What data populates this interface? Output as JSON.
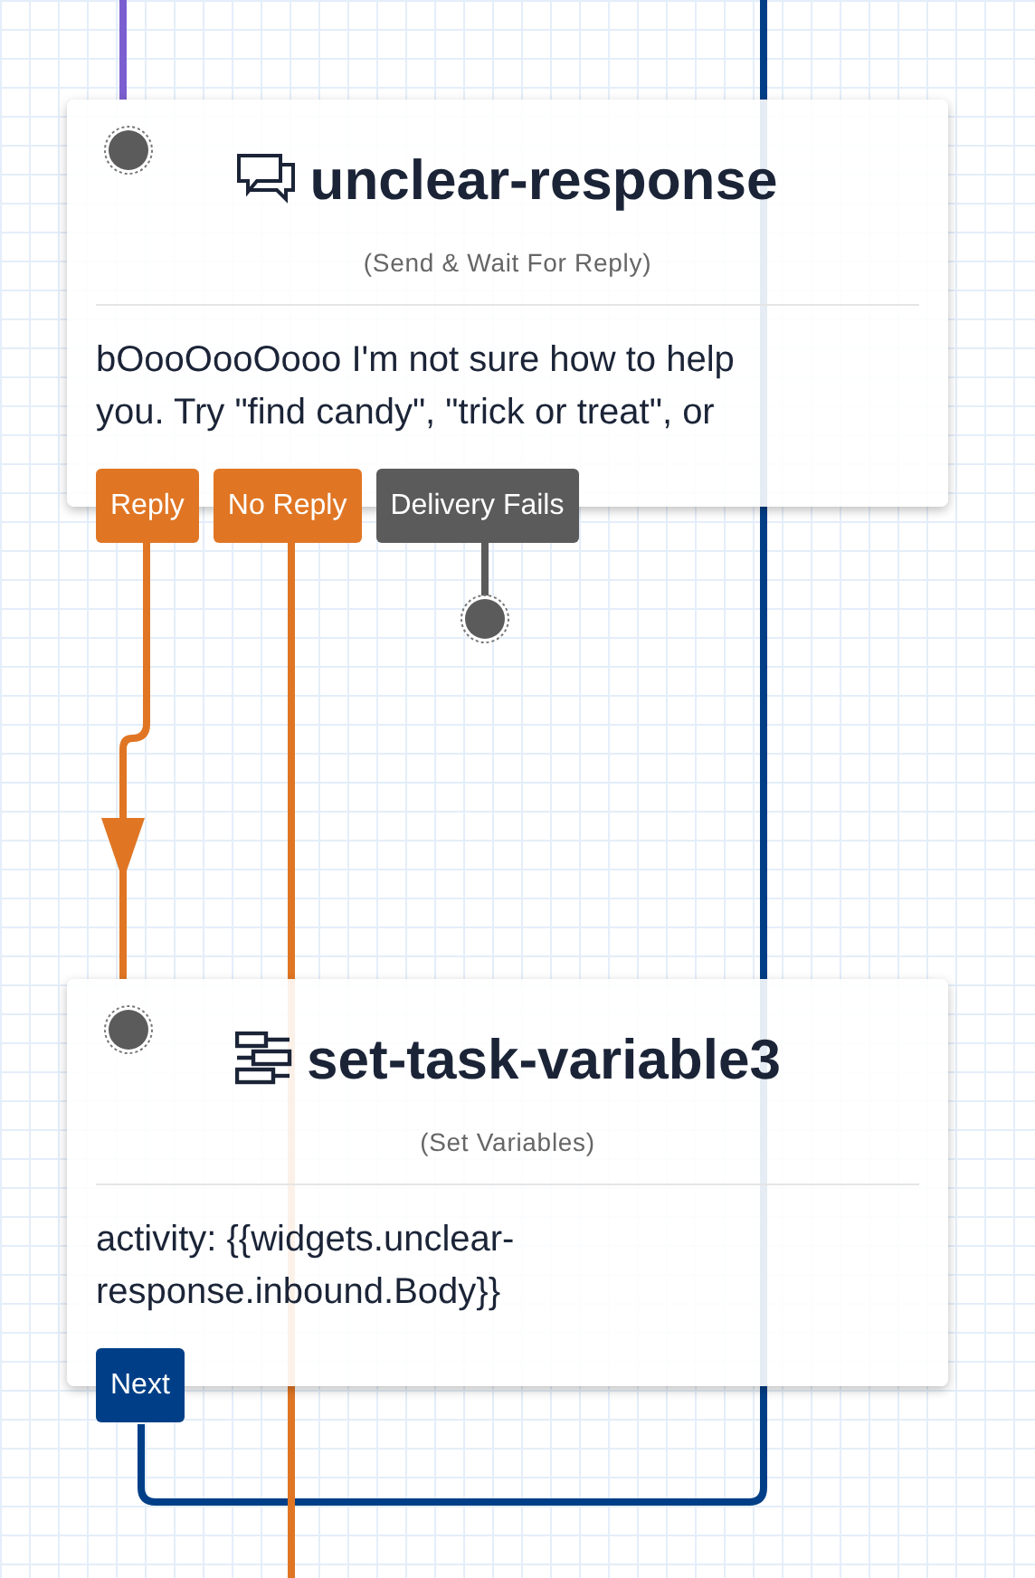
{
  "nodes": [
    {
      "title": "unclear-response",
      "kind": "send-and-wait",
      "type_label": "(Send & Wait For Reply)",
      "body": "bOooOooOooo I'm not sure how to help you. Try \"find candy\", \"trick or treat\", or",
      "transitions": [
        {
          "label": "Reply",
          "color": "#e07624"
        },
        {
          "label": "No Reply",
          "color": "#e07624"
        },
        {
          "label": "Delivery Fails",
          "color": "#5b5b5b"
        }
      ]
    },
    {
      "title": "set-task-variable3",
      "kind": "set-variables",
      "type_label": "(Set Variables)",
      "body": "activity: {{widgets.unclear-response.inbound.Body}}",
      "transitions": [
        {
          "label": "Next",
          "color": "#003f87"
        }
      ]
    }
  ]
}
